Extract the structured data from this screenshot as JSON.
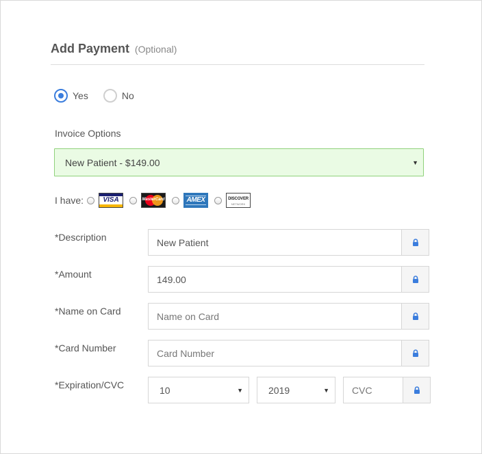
{
  "header": {
    "title": "Add Payment",
    "optional": "(Optional)"
  },
  "payment_toggle": {
    "options": [
      {
        "label": "Yes",
        "checked": true
      },
      {
        "label": "No",
        "checked": false
      }
    ]
  },
  "invoice": {
    "label": "Invoice Options",
    "selected": "New Patient - $149.00"
  },
  "cards": {
    "label": "I have:",
    "types": [
      {
        "name": "VISA"
      },
      {
        "name": "MasterCard"
      },
      {
        "name": "AMEX"
      },
      {
        "name": "DISCOVER"
      }
    ],
    "discover_sub": "NETWORK"
  },
  "fields": {
    "description": {
      "label": "*Description",
      "value": "New Patient",
      "placeholder": ""
    },
    "amount": {
      "label": "*Amount",
      "value": "149.00",
      "placeholder": ""
    },
    "name_on_card": {
      "label": "*Name on Card",
      "value": "",
      "placeholder": "Name on Card"
    },
    "card_number": {
      "label": "*Card Number",
      "value": "",
      "placeholder": "Card Number"
    },
    "expiration": {
      "label": "*Expiration/CVC",
      "month": "10",
      "year": "2019",
      "cvc_placeholder": "CVC"
    }
  },
  "icons": {
    "lock": "lock-icon",
    "caret": "caret-down-icon"
  },
  "colors": {
    "accent": "#3b7ddd",
    "invoice_bg": "#eafbe4",
    "invoice_border": "#8fd17a"
  }
}
